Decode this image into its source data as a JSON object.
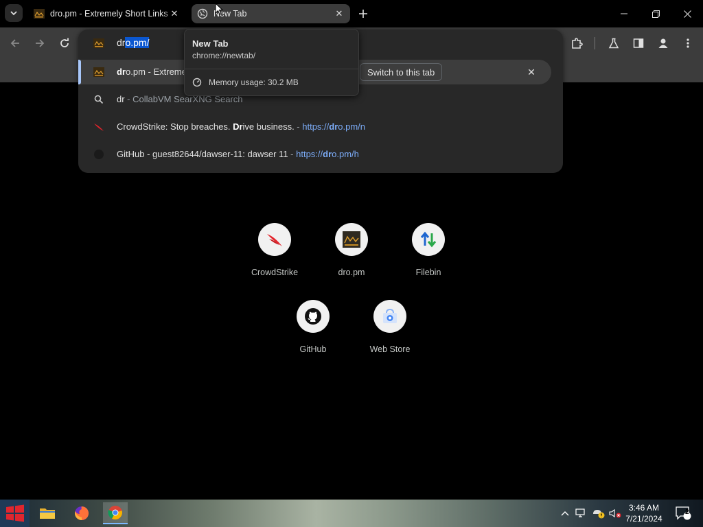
{
  "tabs": [
    {
      "title": "dro.pm - Extremely Short Links",
      "active": false
    },
    {
      "title": "New Tab",
      "active": true
    }
  ],
  "omnibox": {
    "typed": "dr",
    "autocomplete": "o.pm/",
    "suggestions": [
      {
        "type": "switch",
        "bold": "dr",
        "rest": "o.pm - Extremely Short Links",
        "action": "Switch to this tab"
      },
      {
        "type": "search",
        "query": "dr",
        "engine": " - CollabVM SearXNG Search"
      },
      {
        "type": "history",
        "title_pre": "CrowdStrike: Stop breaches. ",
        "title_bold": "Dr",
        "title_post": "ive business.",
        "sep": " - ",
        "url_pre": "https://",
        "url_bold": "dr",
        "url_post": "o.pm/n"
      },
      {
        "type": "history",
        "title_pre": "GitHub - guest82644/dawser-11: dawser 11",
        "title_bold": "",
        "title_post": "",
        "sep": " - ",
        "url_pre": "https://",
        "url_bold": "dr",
        "url_post": "o.pm/h"
      }
    ]
  },
  "hovercard": {
    "title": "New Tab",
    "url": "chrome://newtab/",
    "memory": "Memory usage: 30.2 MB"
  },
  "shortcuts": [
    {
      "label": "CrowdStrike",
      "icon": "crowdstrike-icon"
    },
    {
      "label": "dro.pm",
      "icon": "dro-pm-icon"
    },
    {
      "label": "Filebin",
      "icon": "filebin-icon"
    },
    {
      "label": "GitHub",
      "icon": "github-icon"
    },
    {
      "label": "Web Store",
      "icon": "web-store-icon"
    }
  ],
  "taskbar": {
    "time": "3:46 AM",
    "date": "7/21/2024",
    "notifications": "2"
  },
  "colors": {
    "accent": "#a8c7fa",
    "url": "#7cacf8",
    "selection": "#0b57d0",
    "toolbar": "#3c3c3c",
    "dropdown": "#282828"
  }
}
